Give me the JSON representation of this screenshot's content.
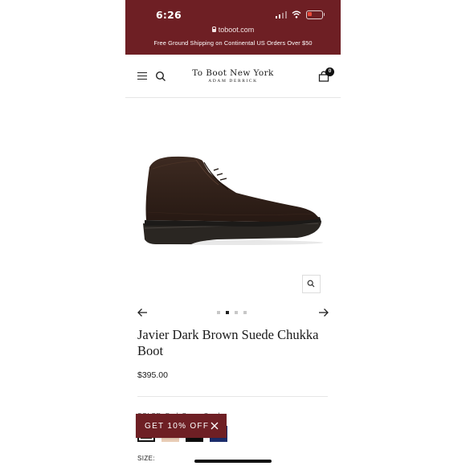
{
  "status_bar": {
    "time": "6:26"
  },
  "browser": {
    "url": "toboot.com"
  },
  "promo_banner": {
    "text": "Free Ground Shipping on Continental US Orders Over $50"
  },
  "header": {
    "logo_main": "To Boot New York",
    "logo_sub": "Adam Derrick",
    "cart_count": "0",
    "icons": [
      "menu-icon",
      "search-icon",
      "shopping-bag-icon"
    ]
  },
  "gallery": {
    "total_images": 4,
    "active_index": 1,
    "icons": [
      "zoom-icon",
      "arrow-left-icon",
      "arrow-right-icon"
    ]
  },
  "product": {
    "title": "Javier Dark Brown Suede Chukka Boot",
    "price": "$395.00",
    "color_label": "COLOR: Dark Brown Suede",
    "swatches": [
      {
        "name": "Dark Brown Suede",
        "color": "#2e211b",
        "selected": true
      },
      {
        "name": "Sand Suede",
        "color": "#e9cdb6",
        "selected": false
      },
      {
        "name": "Black",
        "color": "#0d0d0d",
        "selected": false
      },
      {
        "name": "Navy",
        "color": "#1c2d6b",
        "selected": false
      }
    ],
    "size_label": "SIZE:"
  },
  "discount_popup": {
    "label": "GET 10% OFF"
  },
  "colors": {
    "brand": "#6e1f24",
    "text": "#1a1a1a"
  }
}
